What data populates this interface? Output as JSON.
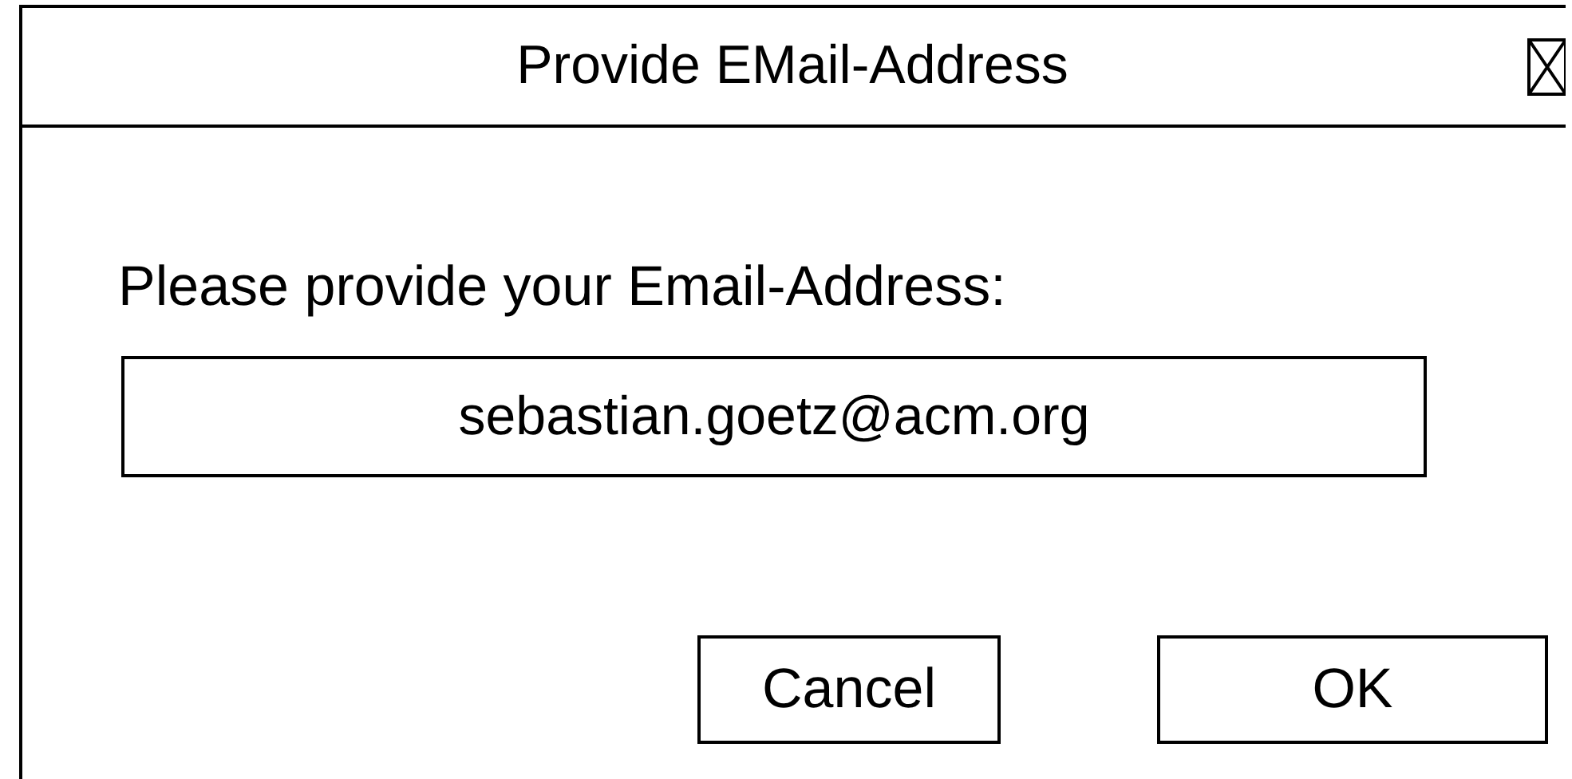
{
  "window": {
    "title": "Provide EMail-Address"
  },
  "prompt": "Please provide your Email-Address:",
  "email_field": {
    "value": "sebastian.goetz@acm.org"
  },
  "buttons": [
    {
      "label": "Cancel",
      "kind": "cancel"
    },
    {
      "label": "OK",
      "kind": "ok"
    }
  ]
}
